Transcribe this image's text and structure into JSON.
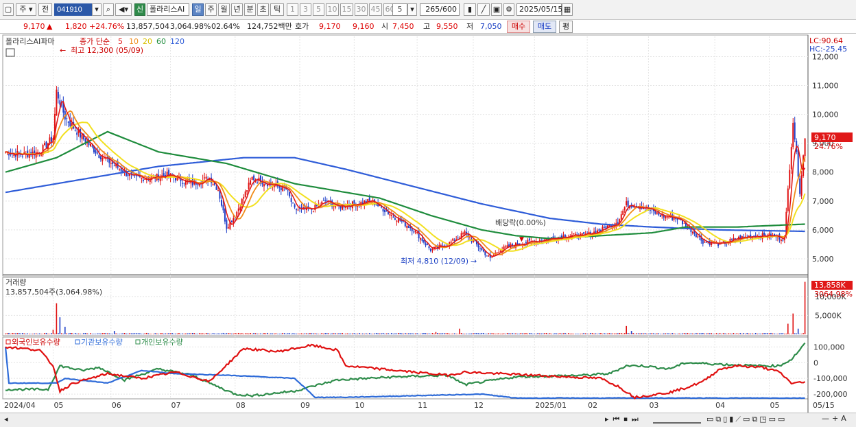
{
  "toolbar": {
    "type_label": "주",
    "prev_label": "전",
    "code": "041910",
    "new_badge": "신",
    "stock_name": "폴라리스AI",
    "periods": [
      "일",
      "주",
      "월",
      "년",
      "분",
      "초",
      "틱"
    ],
    "intervals": [
      "1",
      "3",
      "5",
      "10",
      "15",
      "30",
      "45",
      "60"
    ],
    "interval_value": "5",
    "count": "265",
    "count_total": "/600",
    "date": "2025/05/15"
  },
  "quote": {
    "price": "9,170",
    "up_arrow": "▲",
    "change": "1,820",
    "change_pct": "+24.76%",
    "volume": "13,857,504",
    "volume_pct": "3,064.98%",
    "turnover": "02.64%",
    "amount": "124,752백만",
    "bid_label": "호가",
    "ask": "9,170",
    "bid": "9,160",
    "open_label": "시",
    "open": "7,450",
    "high_label": "고",
    "high": "9,550",
    "low_label": "저",
    "low": "7,050",
    "buy_label": "매수",
    "sell_label": "매도",
    "eval_label": "평"
  },
  "colors": {
    "up": "#e01010",
    "down": "#1f3fc8",
    "ma5": "#e01818",
    "ma10": "#f08c1a",
    "ma20": "#f2e020",
    "ma60": "#1e8c3c",
    "ma120": "#2e5cd8",
    "foreign": "#e01010",
    "institution": "#2e6bd8",
    "individual": "#2e8c4a"
  },
  "chart_data": [
    {
      "type": "candlestick",
      "title": "폴라리스AI파마",
      "legend": [
        "종가 단순",
        "5",
        "10",
        "20",
        "60",
        "120"
      ],
      "ylim": [
        4500,
        12700
      ],
      "yticks": [
        "12,000",
        "11,000",
        "10,000",
        "9,000",
        "8,000",
        "7,000",
        "6,000",
        "5,000"
      ],
      "ytick_values": [
        12000,
        11000,
        10000,
        9000,
        8000,
        7000,
        6000,
        5000
      ],
      "lc_label": "LC:90.64",
      "hc_label": "HC:-25.45",
      "last_price_label": "9,170",
      "last_pct_label": "24.76%",
      "high_annotation": "최고 12,300 (05/09)",
      "low_annotation": "최저 4,810 (12/09)",
      "ex_div_annotation": "배당락(0.00%)",
      "x_labels": [
        "2024/04",
        "05",
        "06",
        "07",
        "08",
        "09",
        "10",
        "11",
        "12",
        "2025/01",
        "02",
        "03",
        "04",
        "05"
      ],
      "x_label_end": "05/15",
      "close_anchors": [
        [
          0,
          8700
        ],
        [
          10,
          8600
        ],
        [
          20,
          8700
        ],
        [
          28,
          9200
        ],
        [
          30,
          10800
        ],
        [
          35,
          9900
        ],
        [
          45,
          9200
        ],
        [
          55,
          8600
        ],
        [
          65,
          8200
        ],
        [
          75,
          7800
        ],
        [
          85,
          7800
        ],
        [
          95,
          7900
        ],
        [
          110,
          7600
        ],
        [
          120,
          7800
        ],
        [
          125,
          7400
        ],
        [
          130,
          6100
        ],
        [
          135,
          6500
        ],
        [
          145,
          7800
        ],
        [
          155,
          7600
        ],
        [
          165,
          7400
        ],
        [
          170,
          6700
        ],
        [
          180,
          6700
        ],
        [
          188,
          7000
        ],
        [
          195,
          6800
        ],
        [
          205,
          6900
        ],
        [
          215,
          7000
        ],
        [
          225,
          6600
        ],
        [
          240,
          6000
        ],
        [
          250,
          5300
        ],
        [
          260,
          5500
        ],
        [
          270,
          5900
        ],
        [
          280,
          5300
        ],
        [
          285,
          5000
        ],
        [
          290,
          5300
        ],
        [
          300,
          5500
        ],
        [
          310,
          5600
        ],
        [
          320,
          5700
        ],
        [
          330,
          5800
        ],
        [
          340,
          5800
        ],
        [
          350,
          6000
        ],
        [
          360,
          6300
        ],
        [
          365,
          6900
        ],
        [
          375,
          6800
        ],
        [
          385,
          6500
        ],
        [
          395,
          6400
        ],
        [
          405,
          5900
        ],
        [
          410,
          5600
        ],
        [
          420,
          5500
        ],
        [
          430,
          5700
        ],
        [
          440,
          5800
        ],
        [
          450,
          5800
        ],
        [
          458,
          5700
        ],
        [
          460,
          7400
        ],
        [
          463,
          9800
        ],
        [
          467,
          7350
        ],
        [
          470,
          9170
        ]
      ],
      "ma60_anchors": [
        [
          0,
          8000
        ],
        [
          30,
          8500
        ],
        [
          60,
          9400
        ],
        [
          90,
          8700
        ],
        [
          130,
          8300
        ],
        [
          170,
          7600
        ],
        [
          220,
          7100
        ],
        [
          250,
          6500
        ],
        [
          280,
          6000
        ],
        [
          300,
          5800
        ],
        [
          320,
          5700
        ],
        [
          350,
          5800
        ],
        [
          380,
          5900
        ],
        [
          400,
          6100
        ],
        [
          430,
          6100
        ],
        [
          470,
          6200
        ]
      ],
      "ma120_anchors": [
        [
          0,
          7300
        ],
        [
          40,
          7700
        ],
        [
          90,
          8200
        ],
        [
          140,
          8500
        ],
        [
          170,
          8500
        ],
        [
          200,
          8100
        ],
        [
          240,
          7500
        ],
        [
          280,
          6900
        ],
        [
          320,
          6400
        ],
        [
          350,
          6200
        ],
        [
          380,
          6100
        ],
        [
          420,
          6000
        ],
        [
          470,
          5950
        ]
      ]
    },
    {
      "type": "bar",
      "title": "거래량",
      "subtitle": "13,857,504주(3,064.98%)",
      "yticks": [
        "10,000K",
        "5,000K"
      ],
      "ytick_values": [
        10000,
        5000
      ],
      "ylim": [
        0,
        14500
      ],
      "last_label": "13,858K",
      "last_pct_label": "3064.98%",
      "spikes": [
        [
          28,
          1200
        ],
        [
          30,
          8200
        ],
        [
          32,
          4500
        ],
        [
          35,
          2000
        ],
        [
          64,
          900
        ],
        [
          253,
          600
        ],
        [
          267,
          1500
        ],
        [
          365,
          2200
        ],
        [
          368,
          900
        ],
        [
          460,
          2800
        ],
        [
          463,
          5500
        ],
        [
          466,
          1500
        ],
        [
          470,
          13858
        ]
      ]
    },
    {
      "type": "line",
      "legend": [
        "외국인보유수량",
        "기관보유수량",
        "개인보유수량"
      ],
      "ylim": [
        -230000,
        145000
      ],
      "yticks": [
        "100,000",
        "0",
        "-100,000",
        "-200,000"
      ],
      "ytick_values": [
        100000,
        0,
        -100000,
        -200000
      ],
      "foreign_anchors": [
        [
          0,
          100000
        ],
        [
          10,
          90000
        ],
        [
          20,
          80000
        ],
        [
          28,
          -20000
        ],
        [
          32,
          -180000
        ],
        [
          40,
          -130000
        ],
        [
          60,
          -70000
        ],
        [
          80,
          -100000
        ],
        [
          100,
          -60000
        ],
        [
          120,
          -120000
        ],
        [
          140,
          90000
        ],
        [
          160,
          70000
        ],
        [
          180,
          110000
        ],
        [
          195,
          80000
        ],
        [
          200,
          -20000
        ],
        [
          230,
          -50000
        ],
        [
          260,
          -80000
        ],
        [
          270,
          -60000
        ],
        [
          290,
          -70000
        ],
        [
          310,
          -80000
        ],
        [
          330,
          -90000
        ],
        [
          350,
          -100000
        ],
        [
          360,
          -150000
        ],
        [
          370,
          -220000
        ],
        [
          390,
          -190000
        ],
        [
          400,
          -160000
        ],
        [
          410,
          -120000
        ],
        [
          420,
          -40000
        ],
        [
          430,
          -20000
        ],
        [
          445,
          -30000
        ],
        [
          455,
          -60000
        ],
        [
          462,
          -130000
        ],
        [
          470,
          -125000
        ]
      ],
      "institution_anchors": [
        [
          0,
          100000
        ],
        [
          2,
          -130000
        ],
        [
          30,
          -130000
        ],
        [
          35,
          -100000
        ],
        [
          60,
          -130000
        ],
        [
          80,
          -50000
        ],
        [
          100,
          -70000
        ],
        [
          130,
          -80000
        ],
        [
          170,
          -100000
        ],
        [
          182,
          -220000
        ],
        [
          200,
          -220000
        ],
        [
          280,
          -200000
        ],
        [
          300,
          -225000
        ],
        [
          470,
          -225000
        ]
      ],
      "individual_anchors": [
        [
          0,
          -170000
        ],
        [
          25,
          -170000
        ],
        [
          32,
          -20000
        ],
        [
          45,
          -50000
        ],
        [
          55,
          -30000
        ],
        [
          70,
          -110000
        ],
        [
          90,
          -40000
        ],
        [
          110,
          -80000
        ],
        [
          120,
          -130000
        ],
        [
          135,
          -200000
        ],
        [
          145,
          -210000
        ],
        [
          170,
          -180000
        ],
        [
          195,
          -110000
        ],
        [
          230,
          -90000
        ],
        [
          260,
          -80000
        ],
        [
          270,
          -140000
        ],
        [
          300,
          -90000
        ],
        [
          340,
          -80000
        ],
        [
          355,
          -70000
        ],
        [
          365,
          -20000
        ],
        [
          375,
          -20000
        ],
        [
          390,
          -40000
        ],
        [
          400,
          0
        ],
        [
          420,
          -10000
        ],
        [
          440,
          -20000
        ],
        [
          455,
          -20000
        ],
        [
          462,
          20000
        ],
        [
          470,
          120000
        ]
      ]
    }
  ]
}
